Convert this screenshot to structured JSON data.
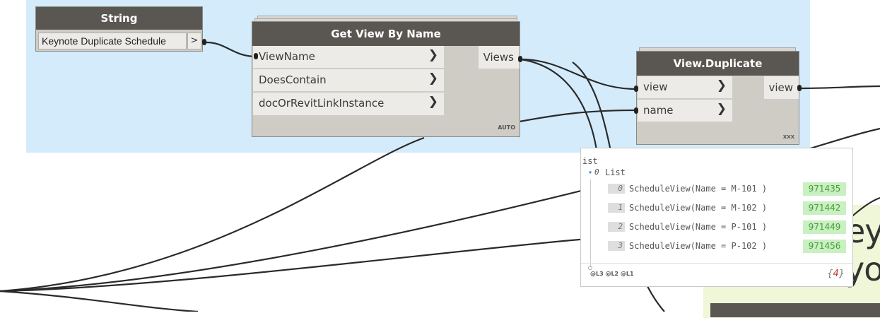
{
  "string_node": {
    "title": "String",
    "value": "Keynote Duplicate Schedule",
    "port": ">"
  },
  "get_view_node": {
    "title": "Get View By Name",
    "inputs": [
      "ViewName",
      "DoesContain",
      "docOrRevitLinkInstance"
    ],
    "output": "Views",
    "lacing": "AUTO"
  },
  "duplicate_node": {
    "title": "View.Duplicate",
    "inputs": [
      "view",
      "name"
    ],
    "output": "view",
    "lacing": "XXX"
  },
  "preview": {
    "header": "ist",
    "list_label": "List",
    "list_index": "0",
    "items": [
      {
        "index": "0",
        "value": "ScheduleView(Name = M-101 )",
        "id": "971435"
      },
      {
        "index": "1",
        "value": "ScheduleView(Name = M-102 )",
        "id": "971442"
      },
      {
        "index": "2",
        "value": "ScheduleView(Name = P-101 )",
        "id": "971449"
      },
      {
        "index": "3",
        "value": "ScheduleView(Name = P-102 )",
        "id": "971456"
      }
    ],
    "levels": "@L3 @L2 @L1",
    "count_open": "{",
    "count": "4",
    "count_close": "}"
  },
  "note": {
    "line1": "eyr",
    "line2": "yo"
  },
  "colors": {
    "group": "#d3ebfb",
    "node_header": "#5a5753",
    "id_badge": "#c8f0c0"
  }
}
